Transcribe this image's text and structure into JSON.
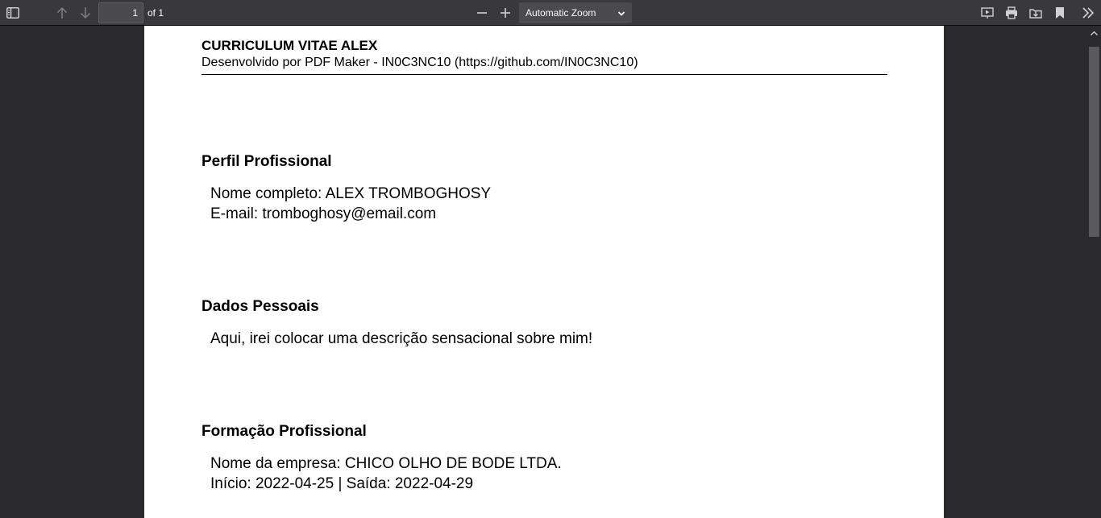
{
  "toolbar": {
    "page_number": "1",
    "page_of": "of 1",
    "zoom_label": "Automatic Zoom",
    "icons": [
      "sidebar-toggle-icon",
      "arrow-up-icon",
      "arrow-down-icon",
      "zoom-out-icon",
      "zoom-in-icon",
      "chevron-down-icon",
      "presentation-icon",
      "print-icon",
      "download-icon",
      "bookmark-icon",
      "double-chevron-right-icon"
    ]
  },
  "document": {
    "title": "CURRICULUM VITAE ALEX",
    "subtitle": "Desenvolvido por PDF Maker - IN0C3NC10 (https://github.com/IN0C3NC10)",
    "sections": [
      {
        "heading": "Perfil Profissional",
        "lines": [
          "Nome completo: ALEX TROMBOGHOSY",
          "E-mail: tromboghosy@email.com"
        ]
      },
      {
        "heading": "Dados Pessoais",
        "lines": [
          "Aqui, irei colocar uma descrição sensacional sobre mim!"
        ]
      },
      {
        "heading": "Formação Profissional",
        "lines": [
          "Nome da empresa: CHICO OLHO DE BODE LTDA.",
          "Início: 2022-04-25 | Saída: 2022-04-29"
        ]
      }
    ]
  },
  "colors": {
    "toolbar_bg": "#38383d",
    "viewer_bg": "#2a2a2e",
    "page_bg": "#ffffff",
    "icon_color": "#d0d0d2"
  }
}
